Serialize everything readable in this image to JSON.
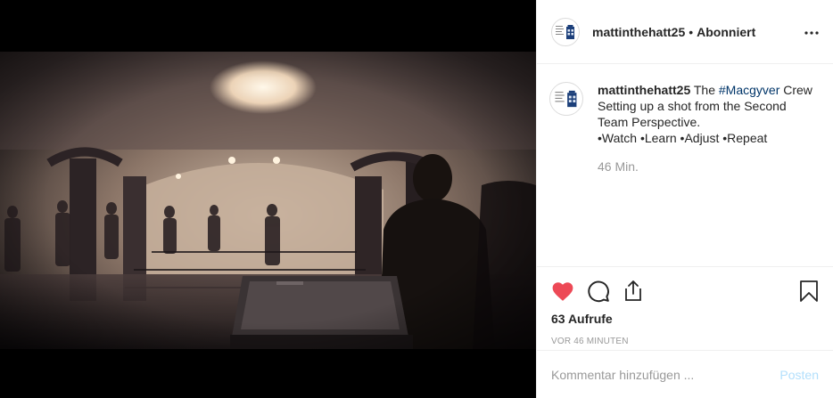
{
  "header": {
    "username": "mattinthehatt25",
    "separator": "•",
    "follow_status": "Abonniert",
    "more_label": "•••"
  },
  "caption": {
    "username": "mattinthehatt25",
    "text_before": " The ",
    "hashtag": "#Macgyver",
    "line1_rest": " Crew",
    "line2": "Setting up a shot from the Second",
    "line3": "Team Perspective.",
    "line4": "•Watch •Learn •Adjust •Repeat",
    "time": "46 Min."
  },
  "actions": {
    "like_icon": "heart-icon",
    "comment_icon": "comment-icon",
    "share_icon": "share-icon",
    "bookmark_icon": "bookmark-icon",
    "liked": true,
    "like_color": "#ed4956"
  },
  "stats": {
    "views": "63 Aufrufe",
    "posted_ago": "vor 46 Minuten"
  },
  "comment_box": {
    "placeholder": "Kommentar hinzufügen ...",
    "post_label": "Posten"
  },
  "colors": {
    "hashtag": "#003569",
    "muted": "#999999",
    "post_disabled": "#b2dffc"
  }
}
